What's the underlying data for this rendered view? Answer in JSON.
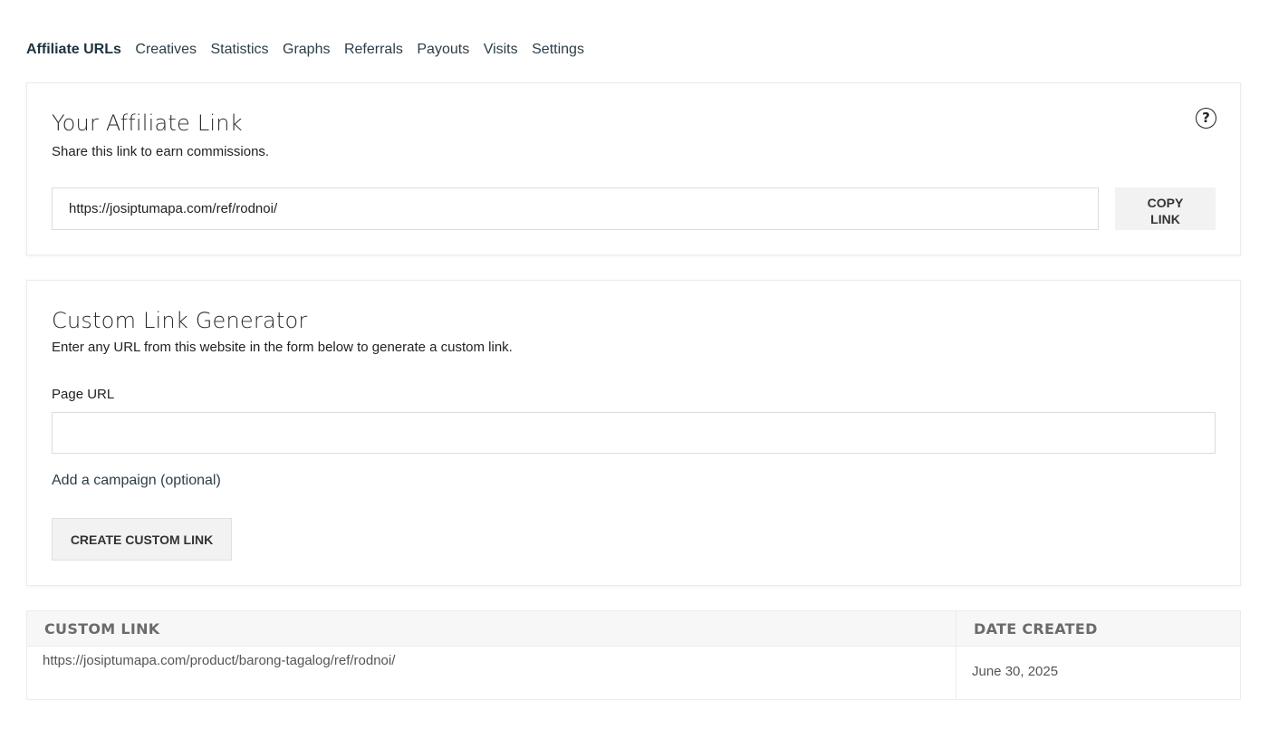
{
  "tabs": [
    "Affiliate URLs",
    "Creatives",
    "Statistics",
    "Graphs",
    "Referrals",
    "Payouts",
    "Visits",
    "Settings"
  ],
  "affiliate_link": {
    "title": "Your Affiliate Link",
    "subtitle": "Share this link to earn commissions.",
    "url": "https://josiptumapa.com/ref/rodnoi/",
    "copy_label": "COPY\nLINK",
    "help_icon": "?"
  },
  "generator": {
    "title": "Custom Link Generator",
    "subtitle": "Enter any URL from this website in the form below to generate a custom link.",
    "page_url_label": "Page URL",
    "page_url_value": "",
    "campaign_link": "Add a campaign (optional)",
    "create_label": "CREATE CUSTOM LINK"
  },
  "table": {
    "headers": [
      "CUSTOM LINK",
      "DATE CREATED"
    ],
    "rows": [
      {
        "link": "https://josiptumapa.com/product/barong-tagalog/ref/rodnoi/",
        "date": "June 30, 2025"
      }
    ]
  }
}
